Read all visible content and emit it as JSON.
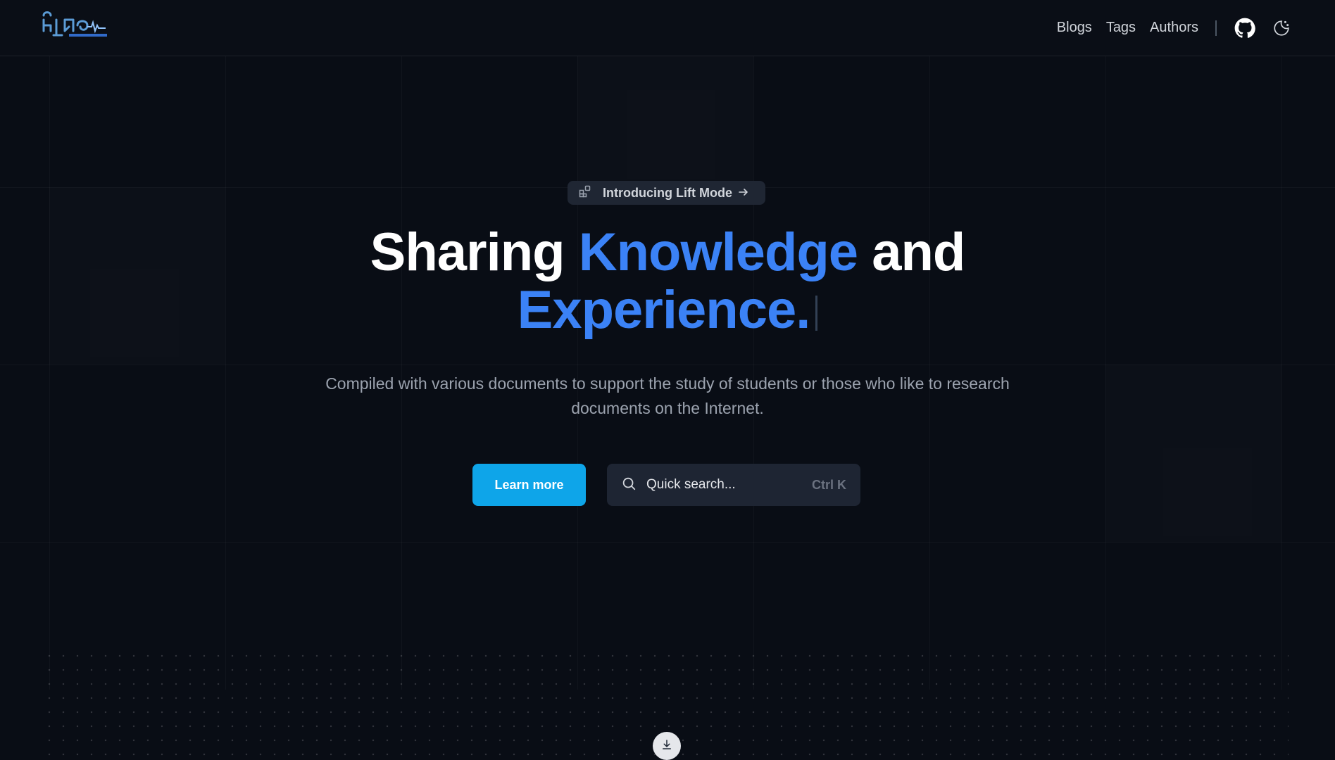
{
  "header": {
    "logo_alt": "site logo",
    "nav": [
      {
        "label": "Blogs"
      },
      {
        "label": "Tags"
      },
      {
        "label": "Authors"
      }
    ],
    "icons": [
      "github-icon",
      "theme-toggle-icon"
    ]
  },
  "hero": {
    "announcement": "Introducing Lift Mode",
    "headline": {
      "part1": "Sharing",
      "part2": "Knowledge",
      "part3": "and",
      "part4": "Experience."
    },
    "subtitle": "Compiled with various documents to support the study of students or those who like to research documents on the Internet.",
    "cta_label": "Learn more",
    "search_placeholder": "Quick search...",
    "search_shortcut": "Ctrl K"
  },
  "colors": {
    "background": "#090d15",
    "accent": "#3b82f6",
    "button": "#0ea5e9"
  }
}
